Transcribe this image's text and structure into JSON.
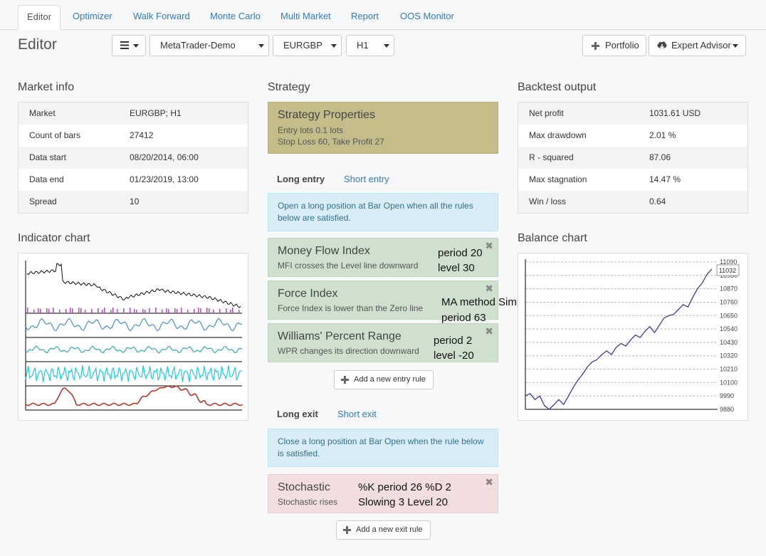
{
  "tabs": [
    {
      "label": "Editor"
    },
    {
      "label": "Optimizer"
    },
    {
      "label": "Walk Forward"
    },
    {
      "label": "Monte Carlo"
    },
    {
      "label": "Multi Market"
    },
    {
      "label": "Report"
    },
    {
      "label": "OOS Monitor"
    }
  ],
  "toolbar": {
    "title": "Editor",
    "server": "MetaTrader-Demo",
    "symbol": "EURGBP",
    "period": "H1",
    "portfolio_label": "Portfolio",
    "expert_label": "Expert Advisor"
  },
  "market_info": {
    "title": "Market info",
    "rows": [
      {
        "k": "Market",
        "v": "EURGBP; H1"
      },
      {
        "k": "Count of bars",
        "v": "27412"
      },
      {
        "k": "Data start",
        "v": "08/20/2014, 06:00"
      },
      {
        "k": "Data end",
        "v": "01/23/2019, 13:00"
      },
      {
        "k": "Spread",
        "v": "10"
      }
    ]
  },
  "indicator_chart": {
    "title": "Indicator chart"
  },
  "strategy": {
    "title": "Strategy",
    "props_title": "Strategy Properties",
    "props_line1": "Entry lots 0.1 lots",
    "props_line2": "Stop Loss 60, Take Profit 27",
    "entry_tab_long": "Long entry",
    "entry_tab_short": "Short entry",
    "entry_info": "Open a long position at Bar Open when all the rules below are satisfied.",
    "entry_rules": [
      {
        "title": "Money Flow Index",
        "desc": "MFI crosses the Level line downward",
        "p1": "period 20",
        "p2": "level 30"
      },
      {
        "title": "Force Index",
        "desc": "Force Index is lower than the Zero line",
        "p1": "MA method Simple",
        "p2": "period 63"
      },
      {
        "title": "Williams' Percent Range",
        "desc": "WPR changes its direction downward",
        "p1": "period 2",
        "p2": "level -20"
      }
    ],
    "add_entry": "Add a new entry rule",
    "exit_tab_long": "Long exit",
    "exit_tab_short": "Short exit",
    "exit_info": "Close a long position at Bar Open when the rule below is satisfied.",
    "exit_rule": {
      "title": "Stochastic",
      "desc": "Stochastic rises",
      "p1": "%K period 26 %D 2",
      "p2": "Slowing 3 Level 20"
    },
    "add_exit": "Add a new exit rule",
    "close_glyph": "✖"
  },
  "backtest": {
    "title": "Backtest output",
    "rows": [
      {
        "k": "Net profit",
        "v": "1031.61 USD"
      },
      {
        "k": "Max drawdown",
        "v": "2.01 %"
      },
      {
        "k": "R - squared",
        "v": "87.06"
      },
      {
        "k": "Max stagnation",
        "v": "14.47 %"
      },
      {
        "k": "Win / loss",
        "v": "0.64"
      }
    ]
  },
  "balance_chart": {
    "title": "Balance chart"
  },
  "chart_data": {
    "type": "line",
    "title": "",
    "ylim": [
      9880,
      11090
    ],
    "y_ticks": [
      "11090",
      "10980",
      "10870",
      "10760",
      "10650",
      "10540",
      "10430",
      "10320",
      "10210",
      "10100",
      "9990",
      "9880"
    ],
    "last_value": "11032",
    "grid": true,
    "values": [
      9990,
      10010,
      9960,
      9990,
      9910,
      9880,
      9920,
      9960,
      9920,
      9990,
      10060,
      10120,
      10170,
      10230,
      10270,
      10290,
      10330,
      10360,
      10330,
      10390,
      10420,
      10400,
      10450,
      10490,
      10470,
      10520,
      10560,
      10510,
      10570,
      10630,
      10650,
      10660,
      10700,
      10740,
      10720,
      10800,
      10870,
      10920,
      10990,
      11032
    ]
  },
  "colors": {
    "accent": "#337ab7",
    "props": "#c4bd8a",
    "entry_rule": "#cfe0cf",
    "exit_rule": "#f2dede",
    "info": "#d9edf7"
  },
  "icons": {
    "menu": "hamburger-icon",
    "plus": "plus-icon",
    "cloud": "cloud-download-icon"
  }
}
